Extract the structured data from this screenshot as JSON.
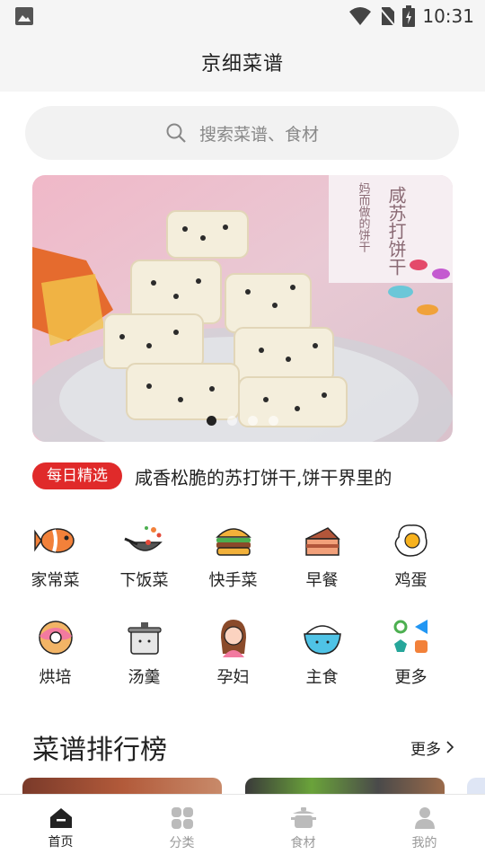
{
  "status_bar": {
    "time": "10:31"
  },
  "app_bar": {
    "title": "京细菜谱"
  },
  "search": {
    "placeholder": "搜索菜谱、食材"
  },
  "banner": {
    "dots": 4,
    "active_dot": 0,
    "image_text": [
      "咸苏打饼干",
      "妈而做的饼干"
    ]
  },
  "daily_pick": {
    "badge": "每日精选",
    "text": "咸香松脆的苏打饼干,饼干界里的"
  },
  "categories": [
    {
      "label": "家常菜",
      "icon": "fish-icon"
    },
    {
      "label": "下饭菜",
      "icon": "wok-icon"
    },
    {
      "label": "快手菜",
      "icon": "burger-icon"
    },
    {
      "label": "早餐",
      "icon": "cake-icon"
    },
    {
      "label": "鸡蛋",
      "icon": "egg-icon"
    },
    {
      "label": "烘培",
      "icon": "donut-icon"
    },
    {
      "label": "汤羹",
      "icon": "pot-icon"
    },
    {
      "label": "孕妇",
      "icon": "woman-icon"
    },
    {
      "label": "主食",
      "icon": "rice-bowl-icon"
    },
    {
      "label": "更多",
      "icon": "shapes-icon"
    }
  ],
  "ranking": {
    "title": "菜谱排行榜",
    "more": "更多"
  },
  "tabs": [
    {
      "label": "首页",
      "icon": "home-icon",
      "active": true
    },
    {
      "label": "分类",
      "icon": "category-icon",
      "active": false
    },
    {
      "label": "食材",
      "icon": "ingredient-pot-icon",
      "active": false
    },
    {
      "label": "我的",
      "icon": "profile-icon",
      "active": false
    }
  ],
  "colors": {
    "accent": "#e02a2a",
    "active_tab": "#222222",
    "inactive_tab": "#999999"
  }
}
